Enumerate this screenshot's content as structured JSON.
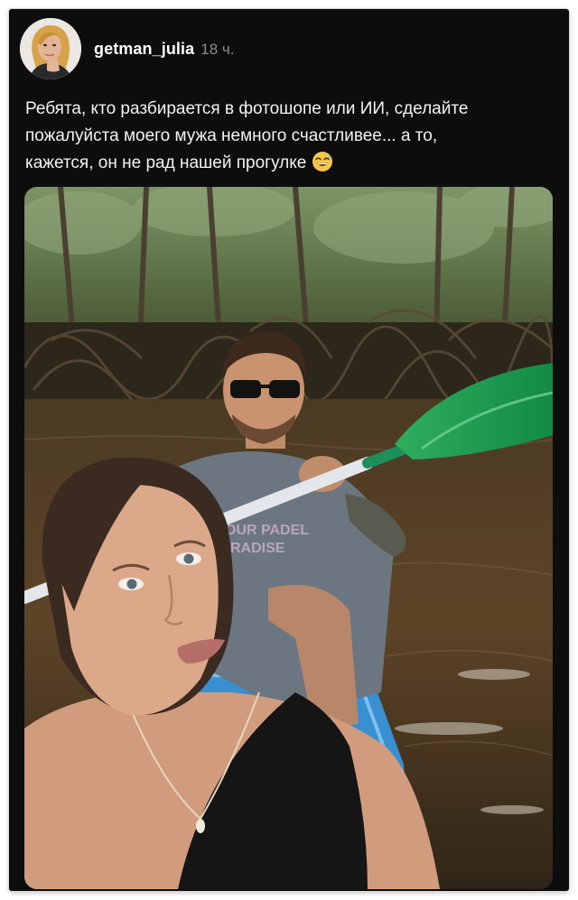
{
  "post": {
    "username": "getman_julia",
    "time": "18 ч.",
    "caption_lines": [
      "Ребята, кто разбирается в фотошопе или ИИ, сделайте",
      "пожалуйста моего мужа немного счастливее... а то,",
      "кажется, он не рад нашей прогулке"
    ],
    "caption_emoji": "grinning-face-with-sweat-icon"
  },
  "photo": {
    "shirt_print": [
      "OUR PADEL",
      "RADISE"
    ]
  },
  "colors": {
    "background": "#0d0d0d",
    "text": "#f2f2f2",
    "muted": "#8a8a8a",
    "paddle": "#1f9a55",
    "kayak": "#3a8fd0"
  }
}
